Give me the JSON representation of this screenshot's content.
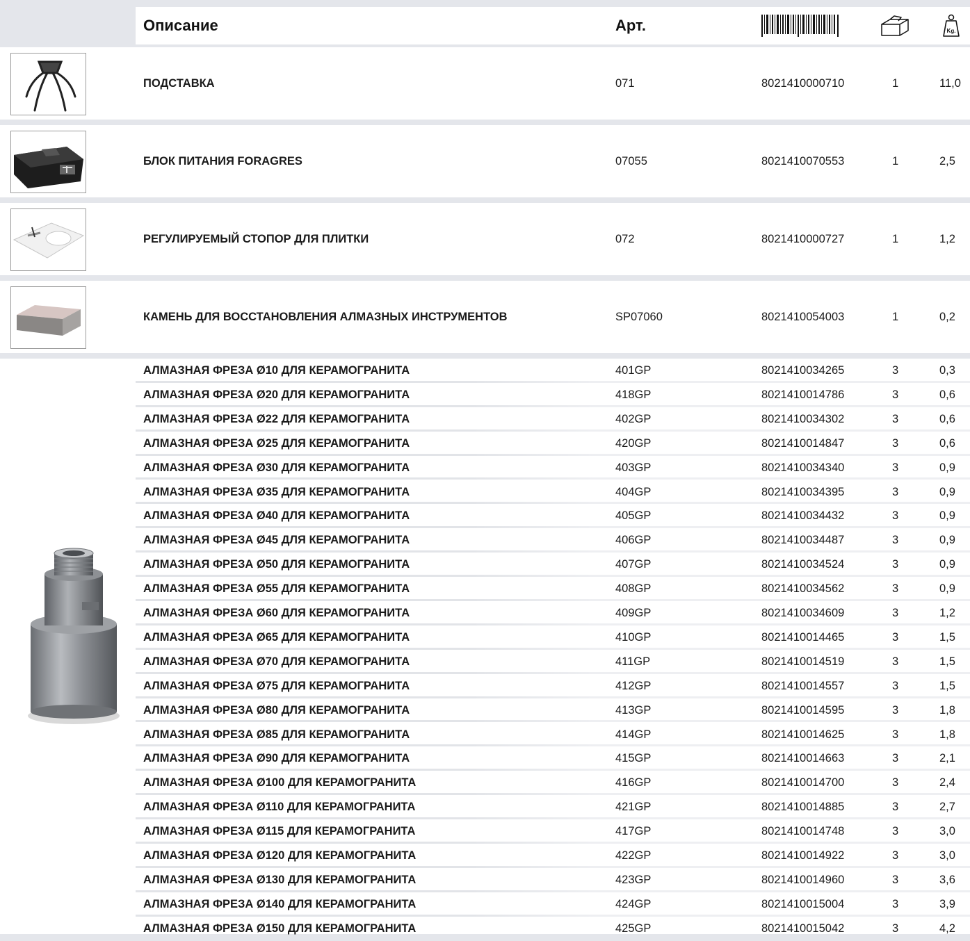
{
  "header": {
    "description": "Описание",
    "article": "Арт.",
    "barcode_icon": "barcode-icon",
    "package_icon": "box-icon",
    "weight_icon": "weight-kg-icon",
    "weight_icon_text": "Kg."
  },
  "products": [
    {
      "description": "ПОДСТАВКА",
      "article": "071",
      "ean": "8021410000710",
      "qty": "1",
      "weight": "11,0",
      "image": "stand-image"
    },
    {
      "description": "БЛОК ПИТАНИЯ FORAGRES",
      "article": "07055",
      "ean": "8021410070553",
      "qty": "1",
      "weight": "2,5",
      "image": "power-unit-image"
    },
    {
      "description": "РЕГУЛИРУЕМЫЙ СТОПОР ДЛЯ ПЛИТКИ",
      "article": "072",
      "ean": "8021410000727",
      "qty": "1",
      "weight": "1,2",
      "image": "tile-stop-image"
    },
    {
      "description": "КАМЕНЬ ДЛЯ ВОССТАНОВЛЕНИЯ АЛМАЗНЫХ ИНСТРУМЕНТОВ",
      "article": "SP07060",
      "ean": "8021410054003",
      "qty": "1",
      "weight": "0,2",
      "image": "dressing-stone-image"
    }
  ],
  "mills": [
    {
      "description": "АЛМАЗНАЯ ФРЕЗА Ø10 ДЛЯ КЕРАМОГРАНИТА",
      "article": "401GP",
      "ean": "8021410034265",
      "qty": "3",
      "weight": "0,3"
    },
    {
      "description": "АЛМАЗНАЯ ФРЕЗА Ø20 ДЛЯ КЕРАМОГРАНИТА",
      "article": "418GP",
      "ean": "8021410014786",
      "qty": "3",
      "weight": "0,6"
    },
    {
      "description": "АЛМАЗНАЯ ФРЕЗА Ø22 ДЛЯ КЕРАМОГРАНИТА",
      "article": "402GP",
      "ean": "8021410034302",
      "qty": "3",
      "weight": "0,6"
    },
    {
      "description": "АЛМАЗНАЯ ФРЕЗА Ø25 ДЛЯ КЕРАМОГРАНИТА",
      "article": "420GP",
      "ean": "8021410014847",
      "qty": "3",
      "weight": "0,6"
    },
    {
      "description": "АЛМАЗНАЯ ФРЕЗА Ø30 ДЛЯ КЕРАМОГРАНИТА",
      "article": "403GP",
      "ean": "8021410034340",
      "qty": "3",
      "weight": "0,9"
    },
    {
      "description": "АЛМАЗНАЯ ФРЕЗА Ø35 ДЛЯ КЕРАМОГРАНИТА",
      "article": "404GP",
      "ean": "8021410034395",
      "qty": "3",
      "weight": "0,9"
    },
    {
      "description": "АЛМАЗНАЯ ФРЕЗА Ø40 ДЛЯ КЕРАМОГРАНИТА",
      "article": "405GP",
      "ean": "8021410034432",
      "qty": "3",
      "weight": "0,9"
    },
    {
      "description": "АЛМАЗНАЯ ФРЕЗА Ø45 ДЛЯ КЕРАМОГРАНИТА",
      "article": "406GP",
      "ean": "8021410034487",
      "qty": "3",
      "weight": "0,9"
    },
    {
      "description": "АЛМАЗНАЯ ФРЕЗА Ø50 ДЛЯ КЕРАМОГРАНИТА",
      "article": "407GP",
      "ean": "8021410034524",
      "qty": "3",
      "weight": "0,9"
    },
    {
      "description": "АЛМАЗНАЯ ФРЕЗА Ø55 ДЛЯ КЕРАМОГРАНИТА",
      "article": "408GP",
      "ean": "8021410034562",
      "qty": "3",
      "weight": "0,9"
    },
    {
      "description": "АЛМАЗНАЯ ФРЕЗА Ø60 ДЛЯ КЕРАМОГРАНИТА",
      "article": "409GP",
      "ean": "8021410034609",
      "qty": "3",
      "weight": "1,2"
    },
    {
      "description": "АЛМАЗНАЯ ФРЕЗА Ø65 ДЛЯ КЕРАМОГРАНИТА",
      "article": "410GP",
      "ean": "8021410014465",
      "qty": "3",
      "weight": "1,5"
    },
    {
      "description": "АЛМАЗНАЯ ФРЕЗА Ø70 ДЛЯ КЕРАМОГРАНИТА",
      "article": "411GP",
      "ean": "8021410014519",
      "qty": "3",
      "weight": "1,5"
    },
    {
      "description": "АЛМАЗНАЯ ФРЕЗА Ø75 ДЛЯ КЕРАМОГРАНИТА",
      "article": "412GP",
      "ean": "8021410014557",
      "qty": "3",
      "weight": "1,5"
    },
    {
      "description": "АЛМАЗНАЯ ФРЕЗА Ø80 ДЛЯ КЕРАМОГРАНИТА",
      "article": "413GP",
      "ean": "8021410014595",
      "qty": "3",
      "weight": "1,8"
    },
    {
      "description": "АЛМАЗНАЯ ФРЕЗА Ø85 ДЛЯ КЕРАМОГРАНИТА",
      "article": "414GP",
      "ean": "8021410014625",
      "qty": "3",
      "weight": "1,8"
    },
    {
      "description": "АЛМАЗНАЯ ФРЕЗА Ø90 ДЛЯ КЕРАМОГРАНИТА",
      "article": "415GP",
      "ean": "8021410014663",
      "qty": "3",
      "weight": "2,1"
    },
    {
      "description": "АЛМАЗНАЯ ФРЕЗА Ø100 ДЛЯ КЕРАМОГРАНИТА",
      "article": "416GP",
      "ean": "8021410014700",
      "qty": "3",
      "weight": "2,4"
    },
    {
      "description": "АЛМАЗНАЯ ФРЕЗА Ø110 ДЛЯ КЕРАМОГРАНИТА",
      "article": "421GP",
      "ean": "8021410014885",
      "qty": "3",
      "weight": "2,7"
    },
    {
      "description": "АЛМАЗНАЯ ФРЕЗА Ø115 ДЛЯ КЕРАМОГРАНИТА",
      "article": "417GP",
      "ean": "8021410014748",
      "qty": "3",
      "weight": "3,0"
    },
    {
      "description": "АЛМАЗНАЯ ФРЕЗА Ø120 ДЛЯ КЕРАМОГРАНИТА",
      "article": "422GP",
      "ean": "8021410014922",
      "qty": "3",
      "weight": "3,0"
    },
    {
      "description": "АЛМАЗНАЯ ФРЕЗА Ø130 ДЛЯ КЕРАМОГРАНИТА",
      "article": "423GP",
      "ean": "8021410014960",
      "qty": "3",
      "weight": "3,6"
    },
    {
      "description": "АЛМАЗНАЯ ФРЕЗА Ø140 ДЛЯ КЕРАМОГРАНИТА",
      "article": "424GP",
      "ean": "8021410015004",
      "qty": "3",
      "weight": "3,9"
    },
    {
      "description": "АЛМАЗНАЯ ФРЕЗА Ø150 ДЛЯ КЕРАМОГРАНИТА",
      "article": "425GP",
      "ean": "8021410015042",
      "qty": "3",
      "weight": "4,2"
    }
  ],
  "mill_image": "diamond-core-bit-image"
}
